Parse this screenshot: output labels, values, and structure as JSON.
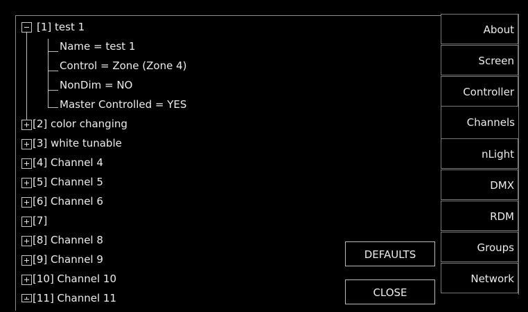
{
  "tree": {
    "root": "[1] test 1",
    "children": [
      "Name = test 1",
      "Control = Zone (Zone 4)",
      "NonDim = NO",
      "Master Controlled = YES"
    ],
    "collapsed": [
      "[2] color changing",
      "[3] white tunable",
      "[4] Channel 4",
      "[5] Channel 5",
      "[6] Channel 6",
      "[7]",
      "[8] Channel 8",
      "[9] Channel 9",
      "[10] Channel 10",
      "[11] Channel 11"
    ]
  },
  "tabs": [
    "About",
    "Screen",
    "Controller",
    "Channels",
    "nLight",
    "DMX",
    "RDM",
    "Groups",
    "Network"
  ],
  "active_tab": "Channels",
  "buttons": {
    "defaults": "DEFAULTS",
    "close": "CLOSE"
  }
}
